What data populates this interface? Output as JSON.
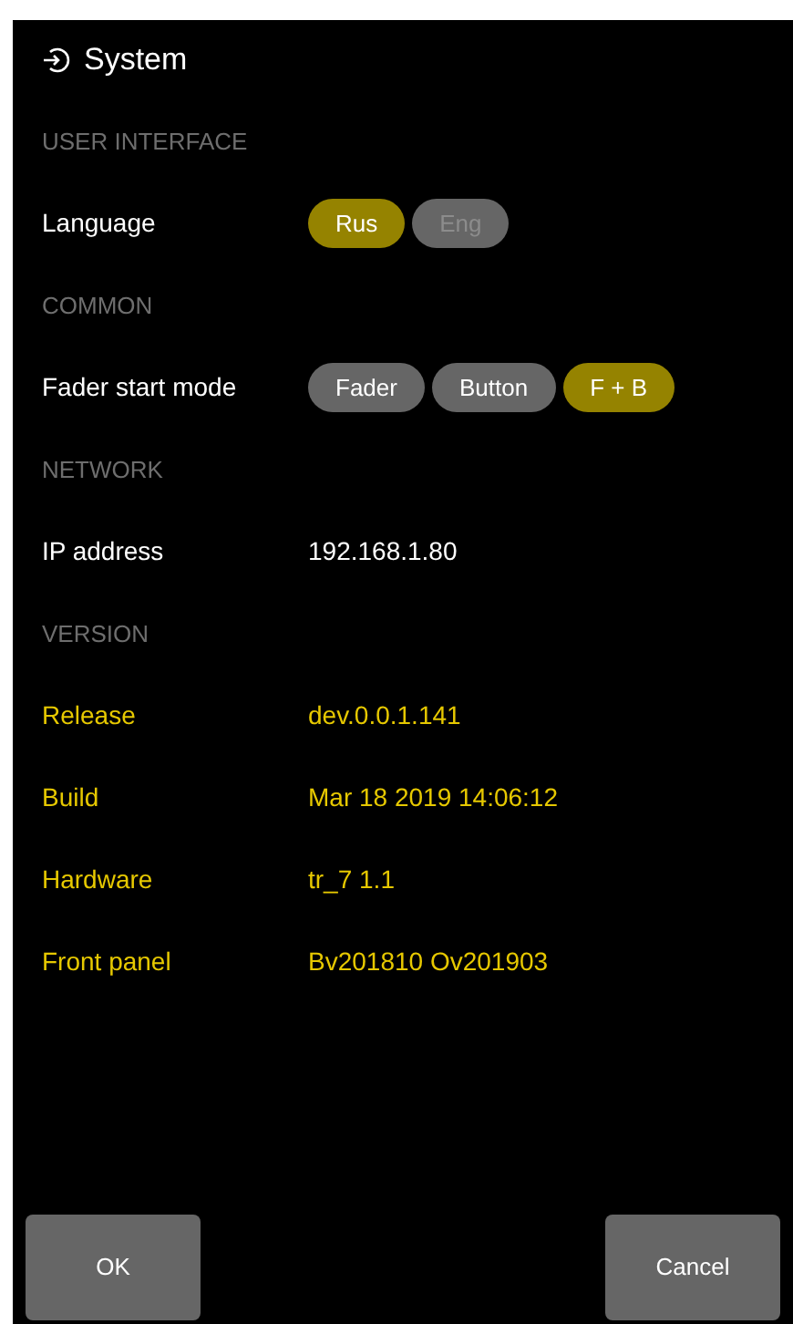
{
  "title": "System",
  "sections": [
    {
      "heading": "USER INTERFACE",
      "rows": [
        {
          "kind": "choice",
          "label": "Language",
          "options": [
            {
              "label": "Rus",
              "selected": true,
              "disabled": false
            },
            {
              "label": "Eng",
              "selected": false,
              "disabled": true
            }
          ]
        }
      ]
    },
    {
      "heading": "COMMON",
      "rows": [
        {
          "kind": "choice",
          "label": "Fader start mode",
          "options": [
            {
              "label": "Fader",
              "selected": false,
              "disabled": false
            },
            {
              "label": "Button",
              "selected": false,
              "disabled": false
            },
            {
              "label": "F + B",
              "selected": true,
              "disabled": false
            }
          ]
        }
      ]
    },
    {
      "heading": "NETWORK",
      "rows": [
        {
          "kind": "value",
          "label": "IP address",
          "value": "192.168.1.80",
          "highlighted": false
        }
      ]
    },
    {
      "heading": "VERSION",
      "rows": [
        {
          "kind": "value",
          "label": "Release",
          "value": "dev.0.0.1.141",
          "highlighted": true
        },
        {
          "kind": "value",
          "label": "Build",
          "value": "Mar 18 2019 14:06:12",
          "highlighted": true
        },
        {
          "kind": "value",
          "label": "Hardware",
          "value": "tr_7 1.1",
          "highlighted": true
        },
        {
          "kind": "value",
          "label": "Front panel",
          "value": "Bv201810 Ov201903",
          "highlighted": true
        }
      ]
    }
  ],
  "buttons": [
    {
      "label": "OK"
    },
    {
      "label": "Cancel"
    }
  ]
}
